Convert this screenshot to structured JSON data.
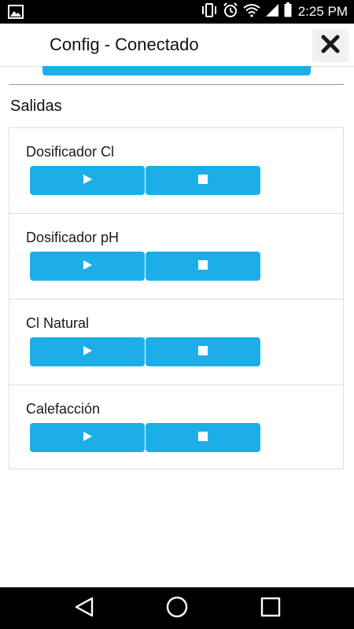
{
  "status_bar": {
    "time": "2:25 PM",
    "icons": [
      "image-icon",
      "vibrate-icon",
      "alarm-icon",
      "wifi-icon",
      "signal-icon",
      "battery-icon"
    ]
  },
  "header": {
    "title": "Config - Conectado",
    "close_icon": "close-icon"
  },
  "section": {
    "title": "Salidas"
  },
  "outputs": [
    {
      "label": "Dosificador Cl"
    },
    {
      "label": "Dosificador pH"
    },
    {
      "label": "Cl Natural"
    },
    {
      "label": "Calefacción"
    }
  ],
  "controls": {
    "play_icon": "play-icon",
    "stop_icon": "stop-icon",
    "button_color": "#1eaee7"
  },
  "nav_bar": {
    "items": [
      "back-icon",
      "home-icon",
      "recents-icon"
    ]
  }
}
